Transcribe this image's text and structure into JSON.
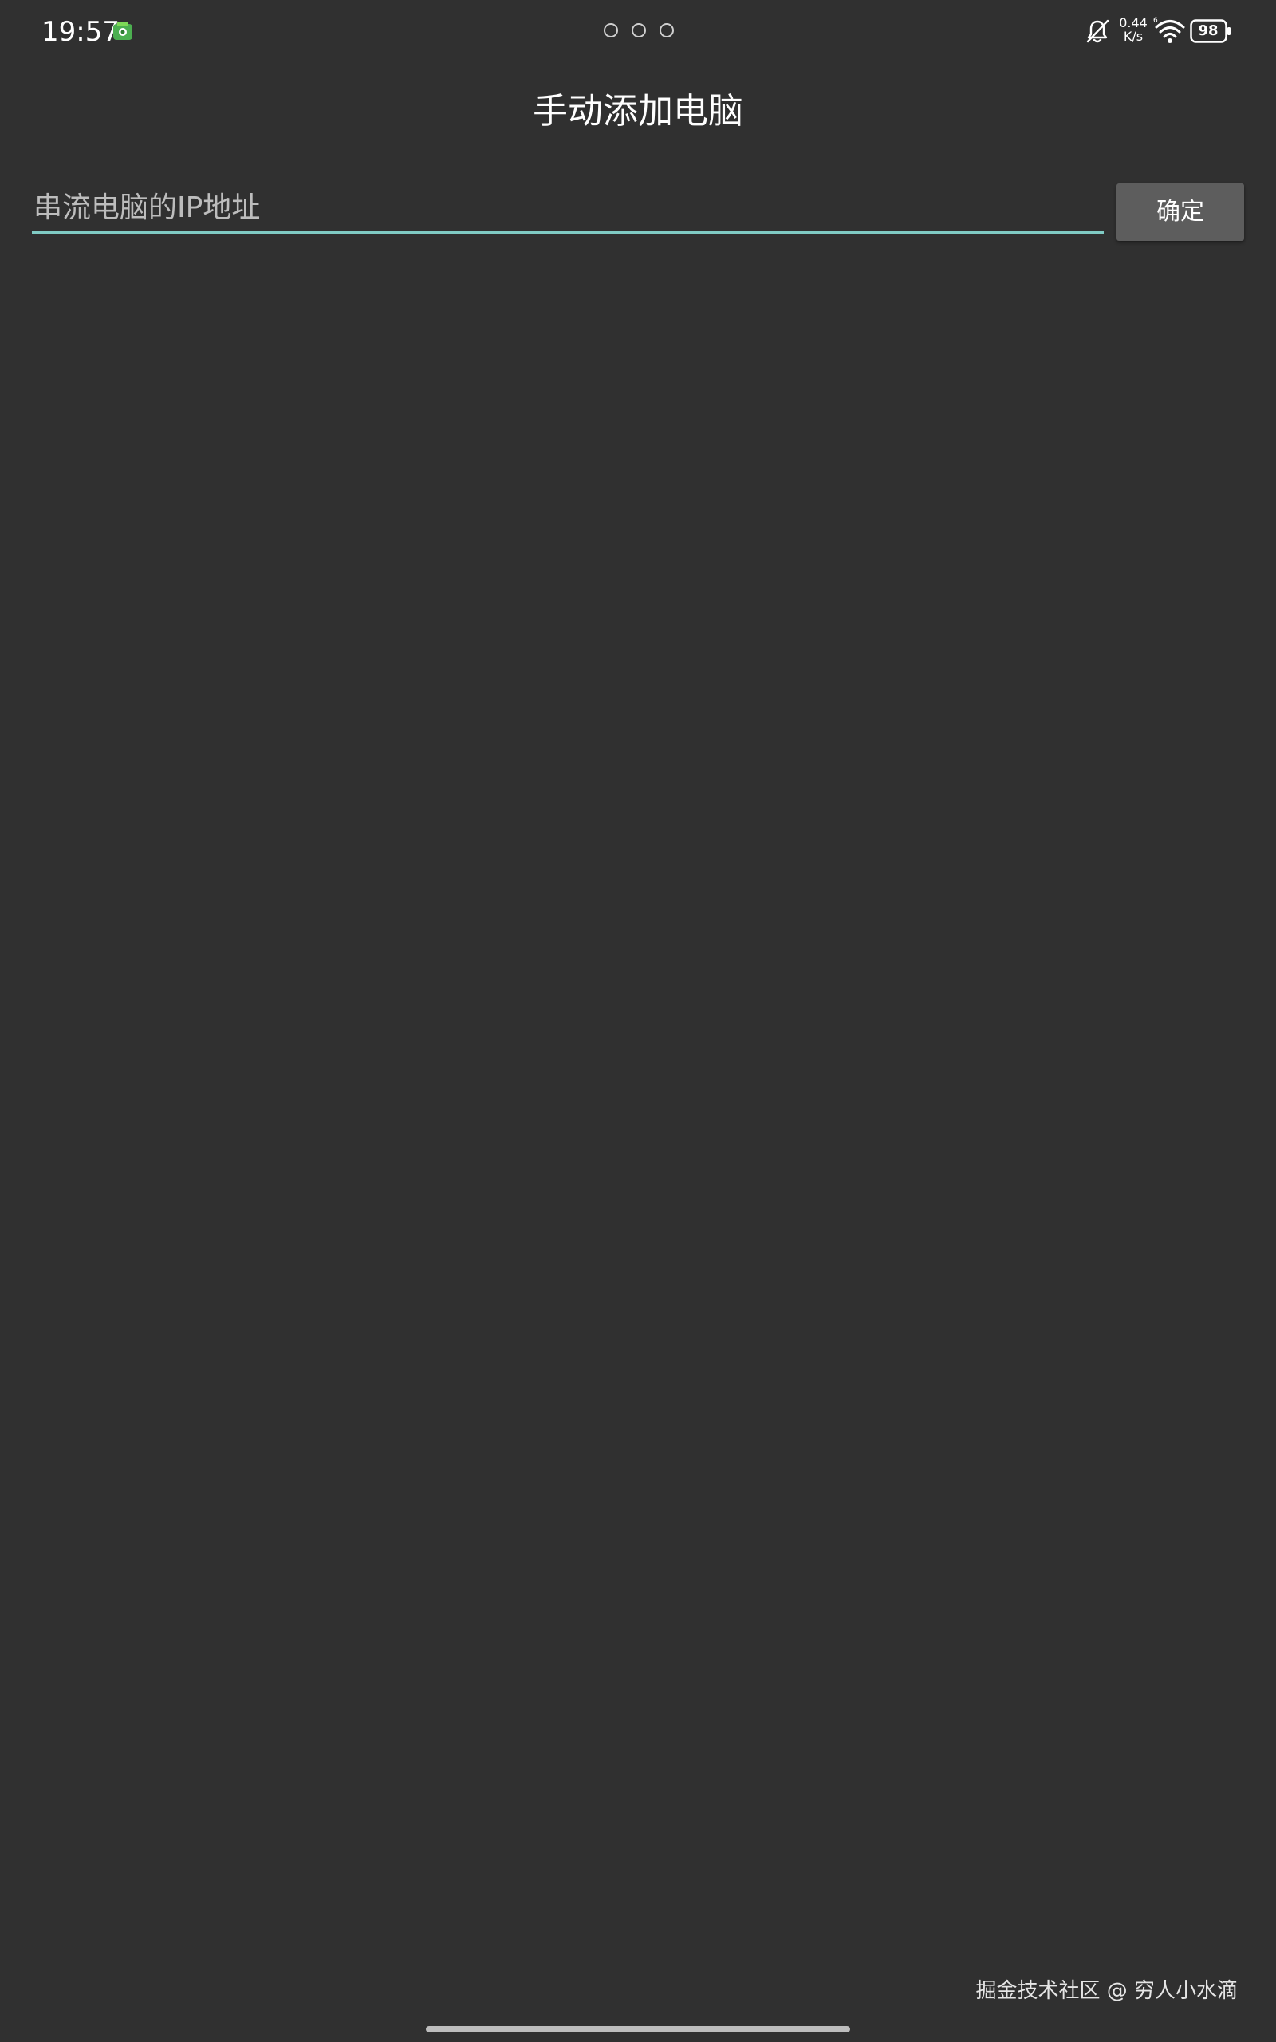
{
  "status_bar": {
    "time": "19:57",
    "net_speed_value": "0.44",
    "net_speed_unit": "K/s",
    "wifi_badge": "6",
    "battery_level": "98",
    "icons": [
      "app-notification-icon",
      "page-dots-icon",
      "bell-muted-icon",
      "wifi-icon",
      "battery-icon"
    ]
  },
  "header": {
    "title": "手动添加电脑"
  },
  "form": {
    "ip_placeholder": "串流电脑的IP地址",
    "ip_value": "",
    "confirm_label": "确定"
  },
  "colors": {
    "background": "#303030",
    "accent_underline": "#80cbc4",
    "button_background": "#5d5d5d",
    "app_icon_green": "#4caf50"
  },
  "watermark": {
    "text": "掘金技术社区 @ 穷人小水滴"
  }
}
